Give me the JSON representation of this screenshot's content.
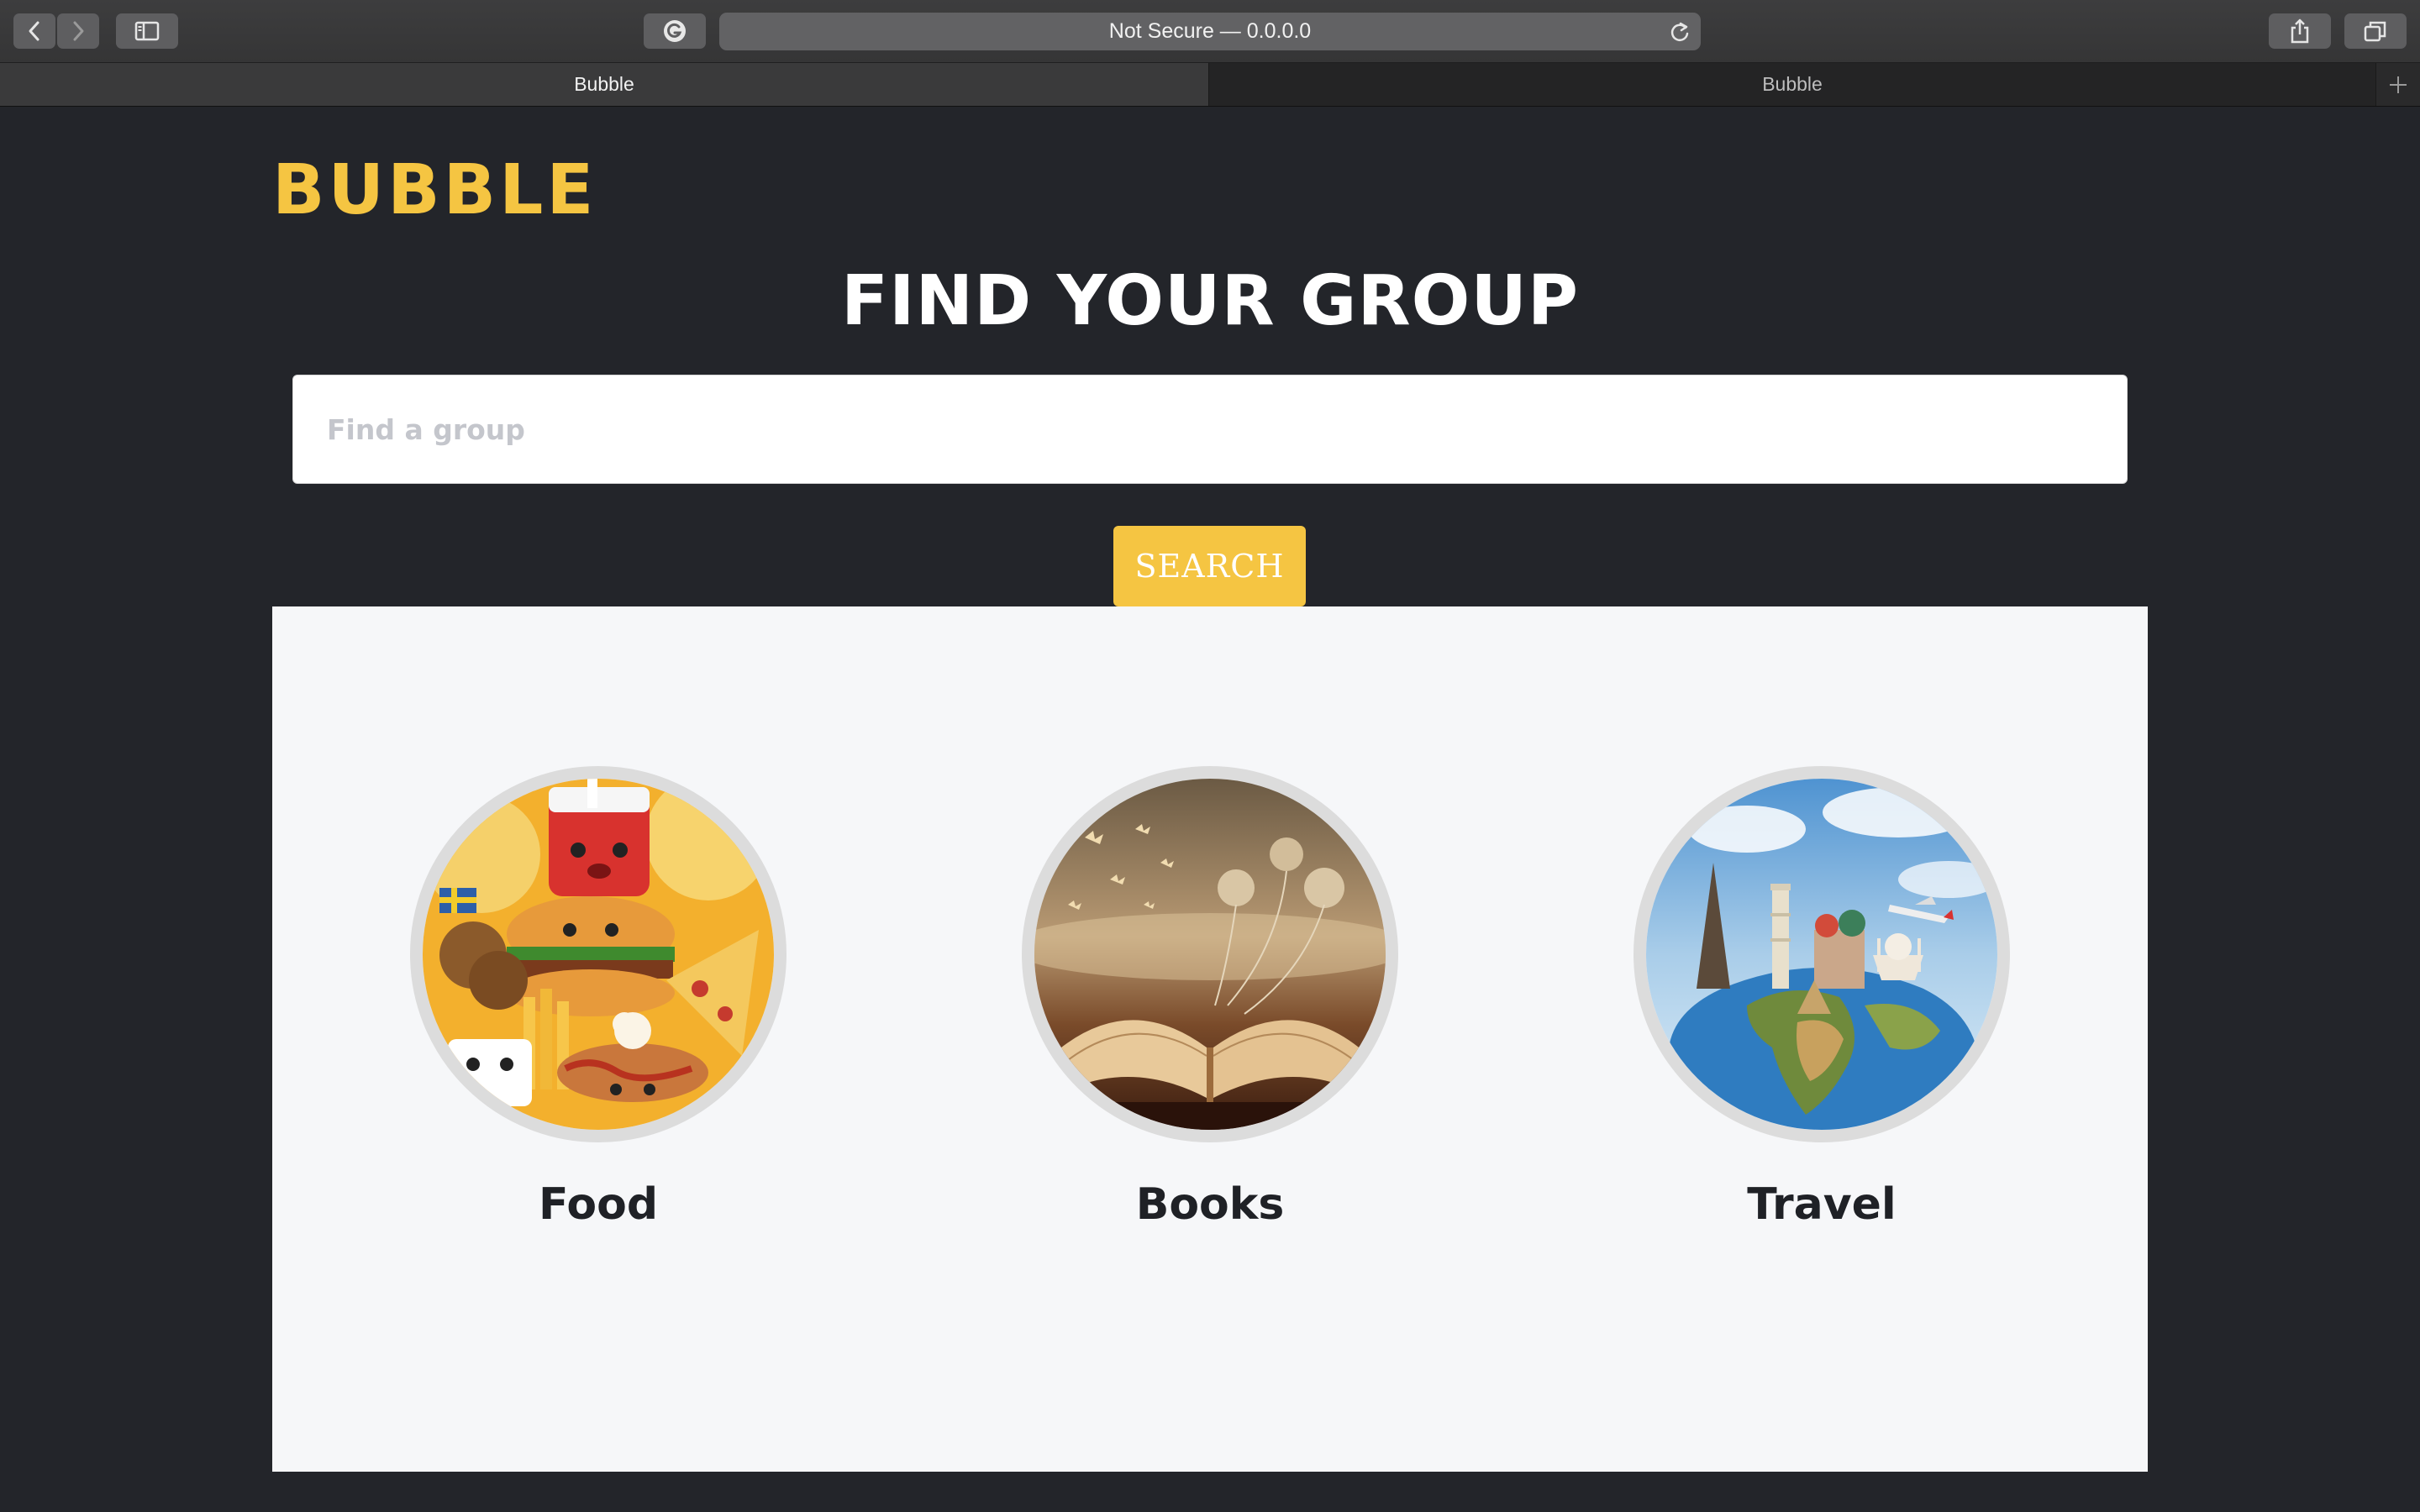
{
  "browser": {
    "address_text": "Not Secure — 0.0.0.0",
    "tabs": [
      {
        "label": "Bubble",
        "active": true
      },
      {
        "label": "Bubble",
        "active": false
      }
    ],
    "icons": [
      "back-icon",
      "forward-icon",
      "sidebar-icon",
      "grammarly-icon",
      "reload-icon",
      "share-icon",
      "tabs-overview-icon",
      "new-tab-icon"
    ]
  },
  "page": {
    "logo": "BUBBLE",
    "headline": "FIND YOUR GROUP",
    "search": {
      "placeholder": "Find a group",
      "value": "",
      "button_label": "SEARCH"
    },
    "groups": [
      {
        "label": "Food",
        "image": "food-illustration"
      },
      {
        "label": "Books",
        "image": "open-book-photo"
      },
      {
        "label": "Travel",
        "image": "world-landmarks-photo"
      }
    ]
  },
  "colors": {
    "page_background": "#23252a",
    "accent": "#f5c542",
    "panel_background": "#f6f7f9",
    "text_dark": "#1f2126"
  }
}
